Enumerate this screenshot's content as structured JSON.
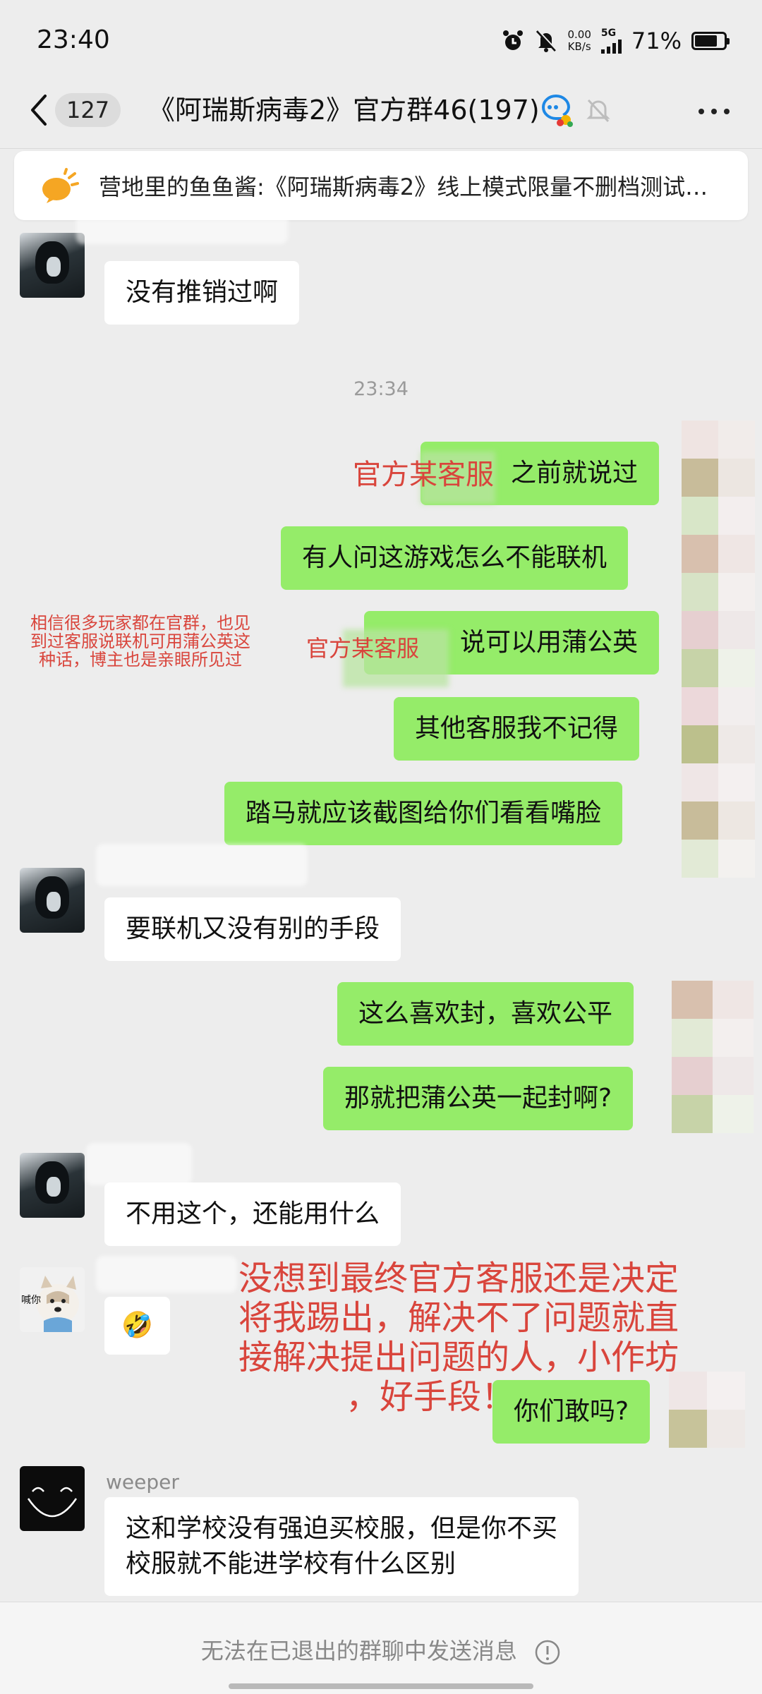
{
  "status_bar": {
    "time": "23:40",
    "net_speed_value": "0.00",
    "net_speed_unit": "KB/s",
    "network_type": "5G",
    "battery": "71%"
  },
  "header": {
    "unread_count": "127",
    "title": "《阿瑞斯病毒2》官方群46(197)"
  },
  "pinned": {
    "text": "营地里的鱼鱼酱:《阿瑞斯病毒2》线上模式限量不删档测试…"
  },
  "messages": [
    {
      "text": "没有推销过啊"
    },
    {
      "timestamp": "23:34"
    },
    {
      "text": "之前就说过"
    },
    {
      "text": "有人问这游戏怎么不能联机"
    },
    {
      "text": "说可以用蒲公英"
    },
    {
      "text": "其他客服我不记得"
    },
    {
      "text": "踏马就应该截图给你们看看嘴脸"
    },
    {
      "text": "要联机又没有别的手段"
    },
    {
      "text": "这么喜欢封，喜欢公平"
    },
    {
      "text": "那就把蒲公英一起封啊?"
    },
    {
      "text": "不用这个，还能用什么"
    },
    {
      "text": "🤣"
    },
    {
      "text": "你们敢吗?"
    },
    {
      "sender": "weeper",
      "text_line1": "这和学校没有强迫买校服，但是你不买",
      "text_line2": "校服就不能进学校有什么区别"
    }
  ],
  "overlays": {
    "label_1": "官方某客服",
    "label_2": "官方某客服",
    "note": "相信很多玩家都在官群，也见到过客服说联机可用蒲公英这种话，博主也是亲眼所见过",
    "big_note_line1": "没想到最终官方客服还是决定",
    "big_note_line2": "将我踢出，解决不了问题就直",
    "big_note_line3": "接解决提出问题的人，小作坊",
    "big_note_line4": "，好手段！"
  },
  "avatar_label": "喊你",
  "bottom_bar": {
    "text": "无法在已退出的群聊中发送消息"
  },
  "colors": {
    "bubble_out": "#95ec69",
    "bubble_in": "#ffffff",
    "background": "#ededed",
    "annotation_red": "#d9453c"
  }
}
